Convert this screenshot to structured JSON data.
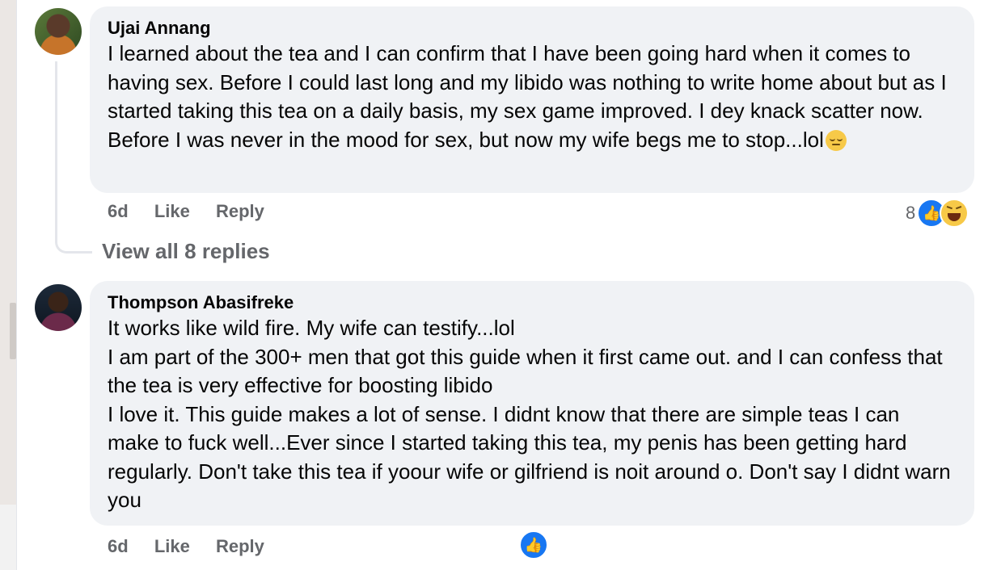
{
  "comments": [
    {
      "author": "Ujai Annang",
      "text": "I learned about the tea and I can confirm that I have been going hard when it comes to having sex. Before I could last long and my libido was nothing to write home about but as I started taking this tea on a daily basis, my sex game improved. I dey knack scatter now. Before I was never in the mood for sex, but now my wife begs me to stop...lol",
      "emoji": "relieved-face-emoji",
      "time": "6d",
      "like_label": "Like",
      "reply_label": "Reply",
      "reaction_count": "8",
      "reactions": [
        "like-icon",
        "haha-icon"
      ],
      "view_replies": "View all 8 replies"
    },
    {
      "author": "Thompson Abasifreke",
      "lines": [
        "It works like wild fire. My wife can testify...lol",
        "I am part of the 300+ men that got this guide when it first came out. and I can confess that the tea is very effective for boosting libido",
        "I love it. This guide makes a lot of sense. I didnt know that there are simple teas I can make to fuck well...Ever since I started taking this tea, my penis has been getting hard regularly. Don't take this tea if yoour wife or gilfriend is noit around o. Don't say I didnt warn you"
      ],
      "time": "6d",
      "like_label": "Like",
      "reply_label": "Reply",
      "reactions": [
        "like-icon"
      ]
    }
  ],
  "colors": {
    "bubble": "#f0f2f5",
    "muted_text": "#65676b",
    "like_blue": "#1877f2"
  }
}
